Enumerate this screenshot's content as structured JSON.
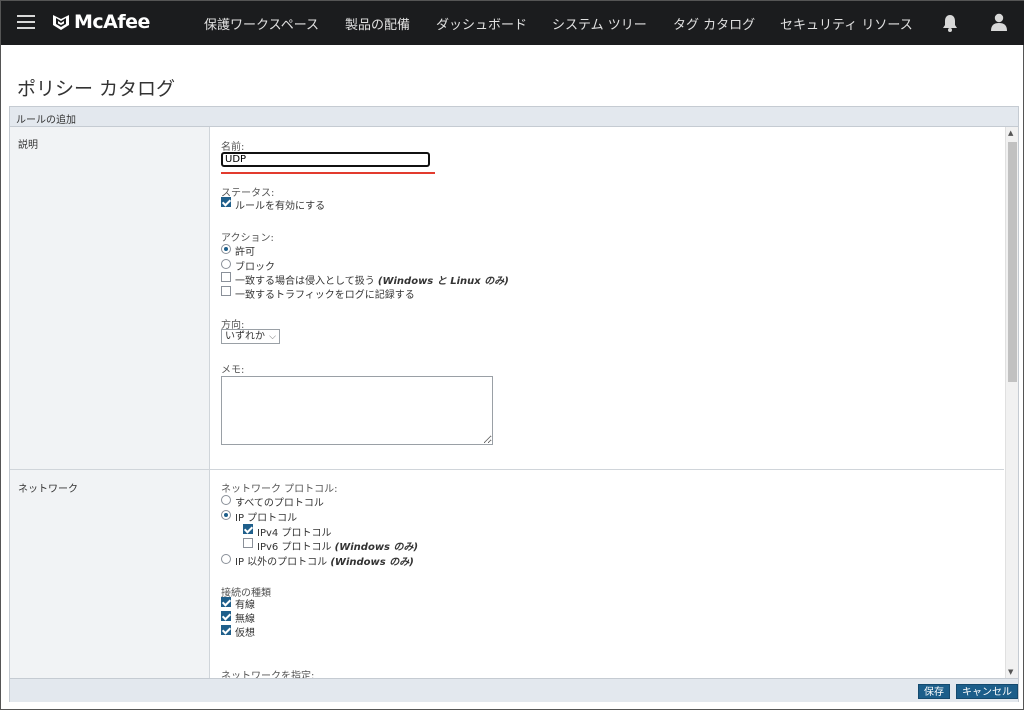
{
  "nav": {
    "brand": "McAfee",
    "items": [
      "保護ワークスペース",
      "製品の配備",
      "ダッシュボード",
      "システム ツリー",
      "タグ カタログ",
      "セキュリティ リソース"
    ],
    "icons": [
      "hamburger-menu-icon",
      "bell-icon",
      "user-icon"
    ]
  },
  "page": {
    "title": "ポリシー カタログ"
  },
  "panel": {
    "header": "ルールの追加"
  },
  "description": {
    "section_label": "説明",
    "name_label": "名前:",
    "name_value": "UDP",
    "status_label": "ステータス:",
    "enable_rule": "ルールを有効にする",
    "action_label": "アクション:",
    "allow": "許可",
    "block": "ブロック",
    "treat_intrusion_prefix": "一致する場合は侵入として扱う",
    "treat_intrusion_suffix": "(Windows と Linux のみ)",
    "log_traffic": "一致するトラフィックをログに記録する",
    "direction_label": "方向:",
    "direction_value": "いずれか",
    "memo_label": "メモ:"
  },
  "network": {
    "section_label": "ネットワーク",
    "protocol_label": "ネットワーク プロトコル:",
    "all_protocols": "すべてのプロトコル",
    "ip_protocol": "IP プロトコル",
    "ipv4": "IPv4 プロトコル",
    "ipv6_prefix": "IPv6 プロトコル",
    "ipv6_suffix": "(Windows のみ)",
    "non_ip_prefix": "IP 以外のプロトコル",
    "non_ip_suffix": "(Windows のみ)",
    "connection_type_label": "接続の種類",
    "wired": "有線",
    "wireless": "無線",
    "virtual": "仮想",
    "specify_network": "ネットワークを指定:"
  },
  "footer": {
    "save": "保存",
    "cancel": "キャンセル"
  },
  "colors": {
    "nav_bg": "#1b1c1e",
    "accent": "#1c5e8a",
    "highlight": "#e23b2e",
    "panel_header": "#e3e8ee"
  }
}
